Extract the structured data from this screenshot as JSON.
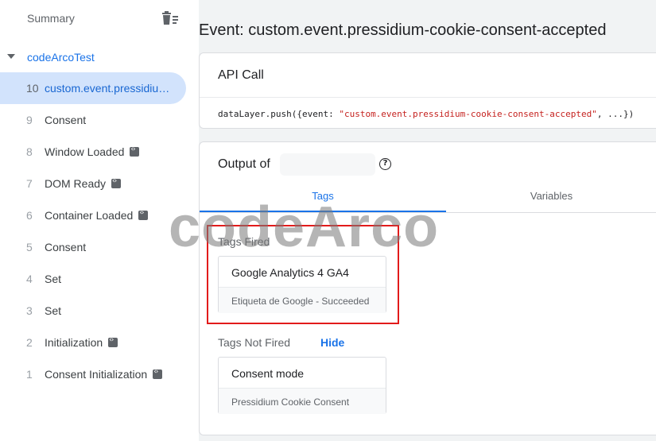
{
  "sidebar": {
    "summary_label": "Summary",
    "container_name": "codeArcoTest",
    "events": [
      {
        "num": "10",
        "name": "custom.event.pressidium-cookie-consent-accepted",
        "active": true,
        "code": false
      },
      {
        "num": "9",
        "name": "Consent",
        "code": false
      },
      {
        "num": "8",
        "name": "Window Loaded",
        "code": true
      },
      {
        "num": "7",
        "name": "DOM Ready",
        "code": true
      },
      {
        "num": "6",
        "name": "Container Loaded",
        "code": true
      },
      {
        "num": "5",
        "name": "Consent",
        "code": false
      },
      {
        "num": "4",
        "name": "Set",
        "code": false
      },
      {
        "num": "3",
        "name": "Set",
        "code": false
      },
      {
        "num": "2",
        "name": "Initialization",
        "code": true
      },
      {
        "num": "1",
        "name": "Consent Initialization",
        "code": true
      }
    ]
  },
  "main": {
    "title": "Event: custom.event.pressidium-cookie-consent-accepted",
    "api_call": {
      "title": "API Call",
      "code_prefix": "dataLayer.push({event: ",
      "code_string": "\"custom.event.pressidium-cookie-consent-accepted\"",
      "code_suffix": ", ...})"
    },
    "output": {
      "title": "Output of",
      "tabs": {
        "tags": "Tags",
        "variables": "Variables"
      },
      "tags_fired_label": "Tags Fired",
      "tags_fired": [
        {
          "name": "Google Analytics 4 GA4",
          "status": "Etiqueta de Google - Succeeded"
        }
      ],
      "tags_not_fired_label": "Tags Not Fired",
      "hide_label": "Hide",
      "tags_not_fired": [
        {
          "name": "Consent mode",
          "status": "Pressidium Cookie Consent"
        }
      ]
    }
  },
  "watermark": "codeArco",
  "colors": {
    "accent": "#1a73e8",
    "active_item_bg": "#d2e3fc",
    "highlight_border": "#e21b1b",
    "code_string": "#c5221f"
  },
  "icons": {
    "summary_action": "trash-list-icon",
    "expand": "caret-down-icon",
    "help": "help-circle-icon",
    "code_badge": "code-brackets-icon"
  }
}
